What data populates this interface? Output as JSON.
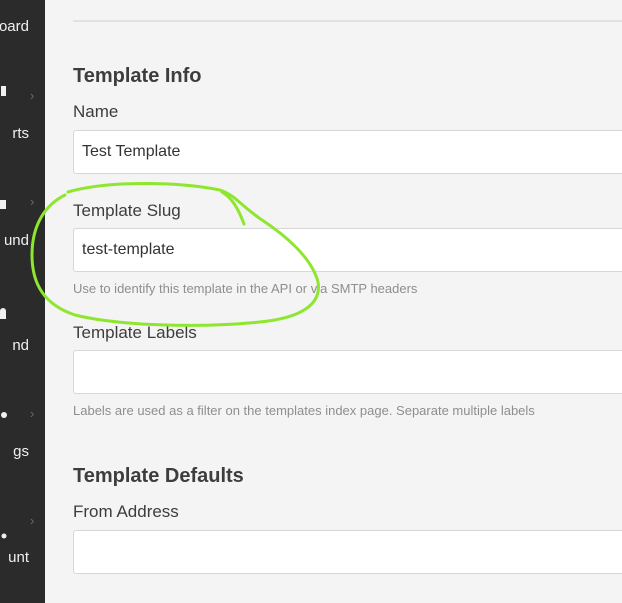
{
  "sidebar": {
    "items": [
      {
        "label": "oard",
        "icon": "dashboard-icon",
        "has_chevron": false
      },
      {
        "label": "rts",
        "icon": "reports-icon",
        "has_chevron": true
      },
      {
        "label": "und",
        "icon": "inbound-icon",
        "has_chevron": true
      },
      {
        "label": "nd",
        "icon": "outbound-icon",
        "has_chevron": false
      },
      {
        "label": "gs",
        "icon": "settings-icon",
        "has_chevron": true
      },
      {
        "label": "unt",
        "icon": "account-icon",
        "has_chevron": true
      }
    ],
    "chevron": "›"
  },
  "template_info": {
    "title": "Template Info",
    "name_label": "Name",
    "name_value": "Test Template",
    "slug_label": "Template Slug",
    "slug_value": "test-template",
    "slug_help": "Use to identify this template in the API or via SMTP headers",
    "labels_label": "Template Labels",
    "labels_value": "",
    "labels_help": "Labels are used as a filter on the templates index page. Separate multiple labels"
  },
  "template_defaults": {
    "title": "Template Defaults",
    "from_address_label": "From Address",
    "from_address_value": ""
  },
  "colors": {
    "sidebar_bg": "#2b2b2b",
    "annotation": "#8ee62f",
    "page_bg": "#f4f4f4"
  }
}
